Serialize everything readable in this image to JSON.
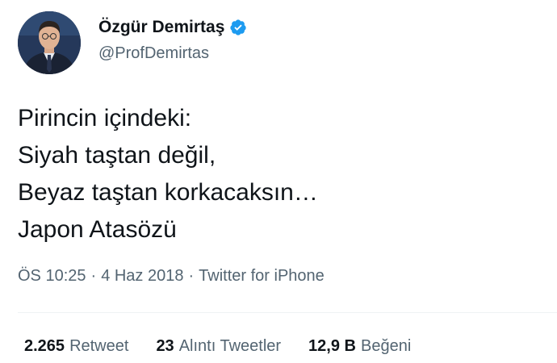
{
  "author": {
    "name": "Özgür Demirtaş",
    "handle": "@ProfDemirtas"
  },
  "tweet": {
    "lines": [
      "Pirincin içindeki:",
      "Siyah taştan değil,",
      "Beyaz taştan korkacaksın…",
      "Japon Atasözü"
    ]
  },
  "meta": {
    "time": "ÖS 10:25",
    "sep1": "·",
    "date": "4 Haz 2018",
    "sep2": "·",
    "source": "Twitter for iPhone"
  },
  "stats": {
    "retweets_count": "2.265",
    "retweets_label": "Retweet",
    "quotes_count": "23",
    "quotes_label": "Alıntı Tweetler",
    "likes_count": "12,9 B",
    "likes_label": "Beğeni"
  },
  "colors": {
    "verified": "#1d9bf0",
    "text": "#0f1419",
    "secondary": "#536471"
  }
}
